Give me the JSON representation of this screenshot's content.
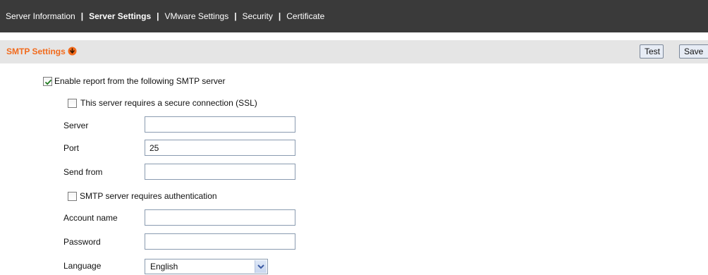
{
  "nav": {
    "items": [
      {
        "label": "Server Information",
        "active": false
      },
      {
        "label": "Server Settings",
        "active": true
      },
      {
        "label": "VMware Settings",
        "active": false
      },
      {
        "label": "Security",
        "active": false
      },
      {
        "label": "Certificate",
        "active": false
      }
    ],
    "separator": "|"
  },
  "section": {
    "title": "SMTP Settings",
    "arrow_icon": "down-arrow-circle-icon",
    "test_label": "Test",
    "save_label": "Save"
  },
  "form": {
    "enable_report": {
      "label": "Enable report from the following SMTP server",
      "checked": true
    },
    "ssl": {
      "label": "This server requires a secure connection (SSL)",
      "checked": false
    },
    "server": {
      "label": "Server",
      "value": ""
    },
    "port": {
      "label": "Port",
      "value": "25"
    },
    "send_from": {
      "label": "Send from",
      "value": ""
    },
    "auth": {
      "label": "SMTP server requires authentication",
      "checked": false
    },
    "account_name": {
      "label": "Account name",
      "value": ""
    },
    "password": {
      "label": "Password",
      "value": ""
    },
    "language": {
      "label": "Language",
      "value": "English"
    }
  },
  "colors": {
    "topbar_bg": "#3a3a3a",
    "section_bg": "#e5e5e5",
    "accent": "#f26b1d",
    "check": "#1f7a1f"
  }
}
